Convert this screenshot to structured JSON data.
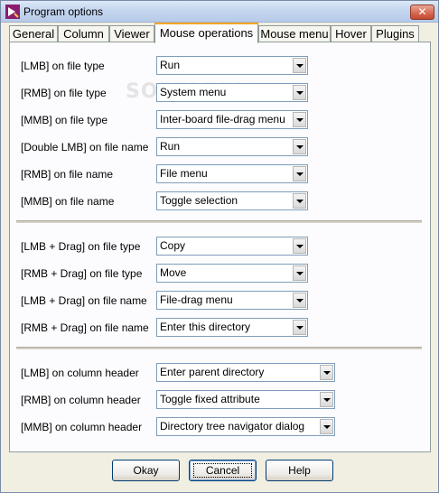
{
  "window": {
    "title": "Program options",
    "close_glyph": "✕"
  },
  "tabs": [
    {
      "label": "General"
    },
    {
      "label": "Column"
    },
    {
      "label": "Viewer"
    },
    {
      "label": "Mouse operations",
      "active": true
    },
    {
      "label": "Mouse menu"
    },
    {
      "label": "Hover"
    },
    {
      "label": "Plugins"
    }
  ],
  "group1": [
    {
      "label": "[LMB] on file type",
      "value": "Run"
    },
    {
      "label": "[RMB] on file type",
      "value": "System menu"
    },
    {
      "label": "[MMB] on file type",
      "value": "Inter-board file-drag menu"
    },
    {
      "label": "[Double LMB] on file name",
      "value": "Run"
    },
    {
      "label": "[RMB] on file name",
      "value": "File menu"
    },
    {
      "label": "[MMB] on file name",
      "value": "Toggle selection"
    }
  ],
  "group2": [
    {
      "label": "[LMB + Drag] on file type",
      "value": "Copy"
    },
    {
      "label": "[RMB + Drag] on file type",
      "value": "Move"
    },
    {
      "label": "[LMB + Drag] on file name",
      "value": "File-drag menu"
    },
    {
      "label": "[RMB + Drag] on file name",
      "value": "Enter this directory"
    }
  ],
  "group3": [
    {
      "label": "[LMB] on column header",
      "value": "Enter parent directory"
    },
    {
      "label": "[RMB] on column header",
      "value": "Toggle fixed attribute"
    },
    {
      "label": "[MMB] on column header",
      "value": "Directory tree navigator dialog"
    }
  ],
  "buttons": {
    "okay": "Okay",
    "cancel": "Cancel",
    "help": "Help"
  },
  "watermark": "SOFTPEDIA",
  "colors": {
    "active_tab_accent": "#f5a623",
    "close_button": "#d66b55",
    "titlebar": "#c4d6ef"
  }
}
